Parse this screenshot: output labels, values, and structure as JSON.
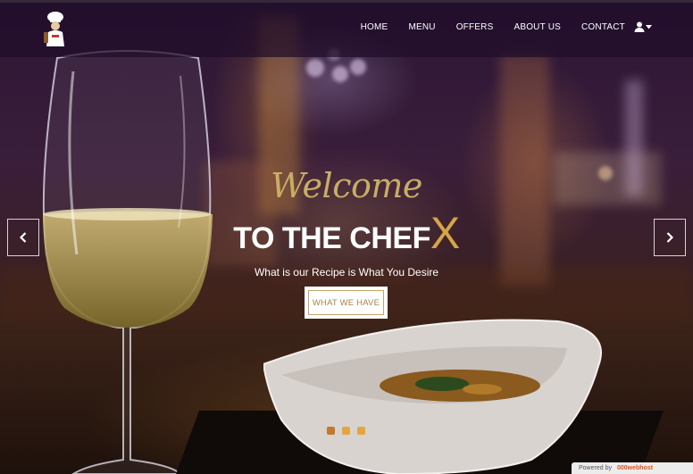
{
  "nav": {
    "items": [
      {
        "label": "HOME"
      },
      {
        "label": "MENU"
      },
      {
        "label": "OFFERS"
      },
      {
        "label": "ABOUT US"
      },
      {
        "label": "CONTACT"
      }
    ],
    "user_icon": "user-icon",
    "dropdown_icon": "caret-down-icon"
  },
  "hero": {
    "welcome": "Welcome",
    "headline_main": "TO THE CHEF",
    "headline_accent": "X",
    "tagline": "What is our Recipe is What You Desire",
    "cta_label": "WHAT WE HAVE",
    "prev_icon": "chevron-left-icon",
    "next_icon": "chevron-right-icon",
    "slides": 3,
    "active_slide": 1
  },
  "badge": {
    "prefix": "Powered by",
    "brand": "000webhost"
  },
  "colors": {
    "gold": "#c9ad67",
    "accent": "#d6a548",
    "nav_bg": "#200c2a",
    "dot": "#e3a63e",
    "dot_active": "#c4782c"
  }
}
